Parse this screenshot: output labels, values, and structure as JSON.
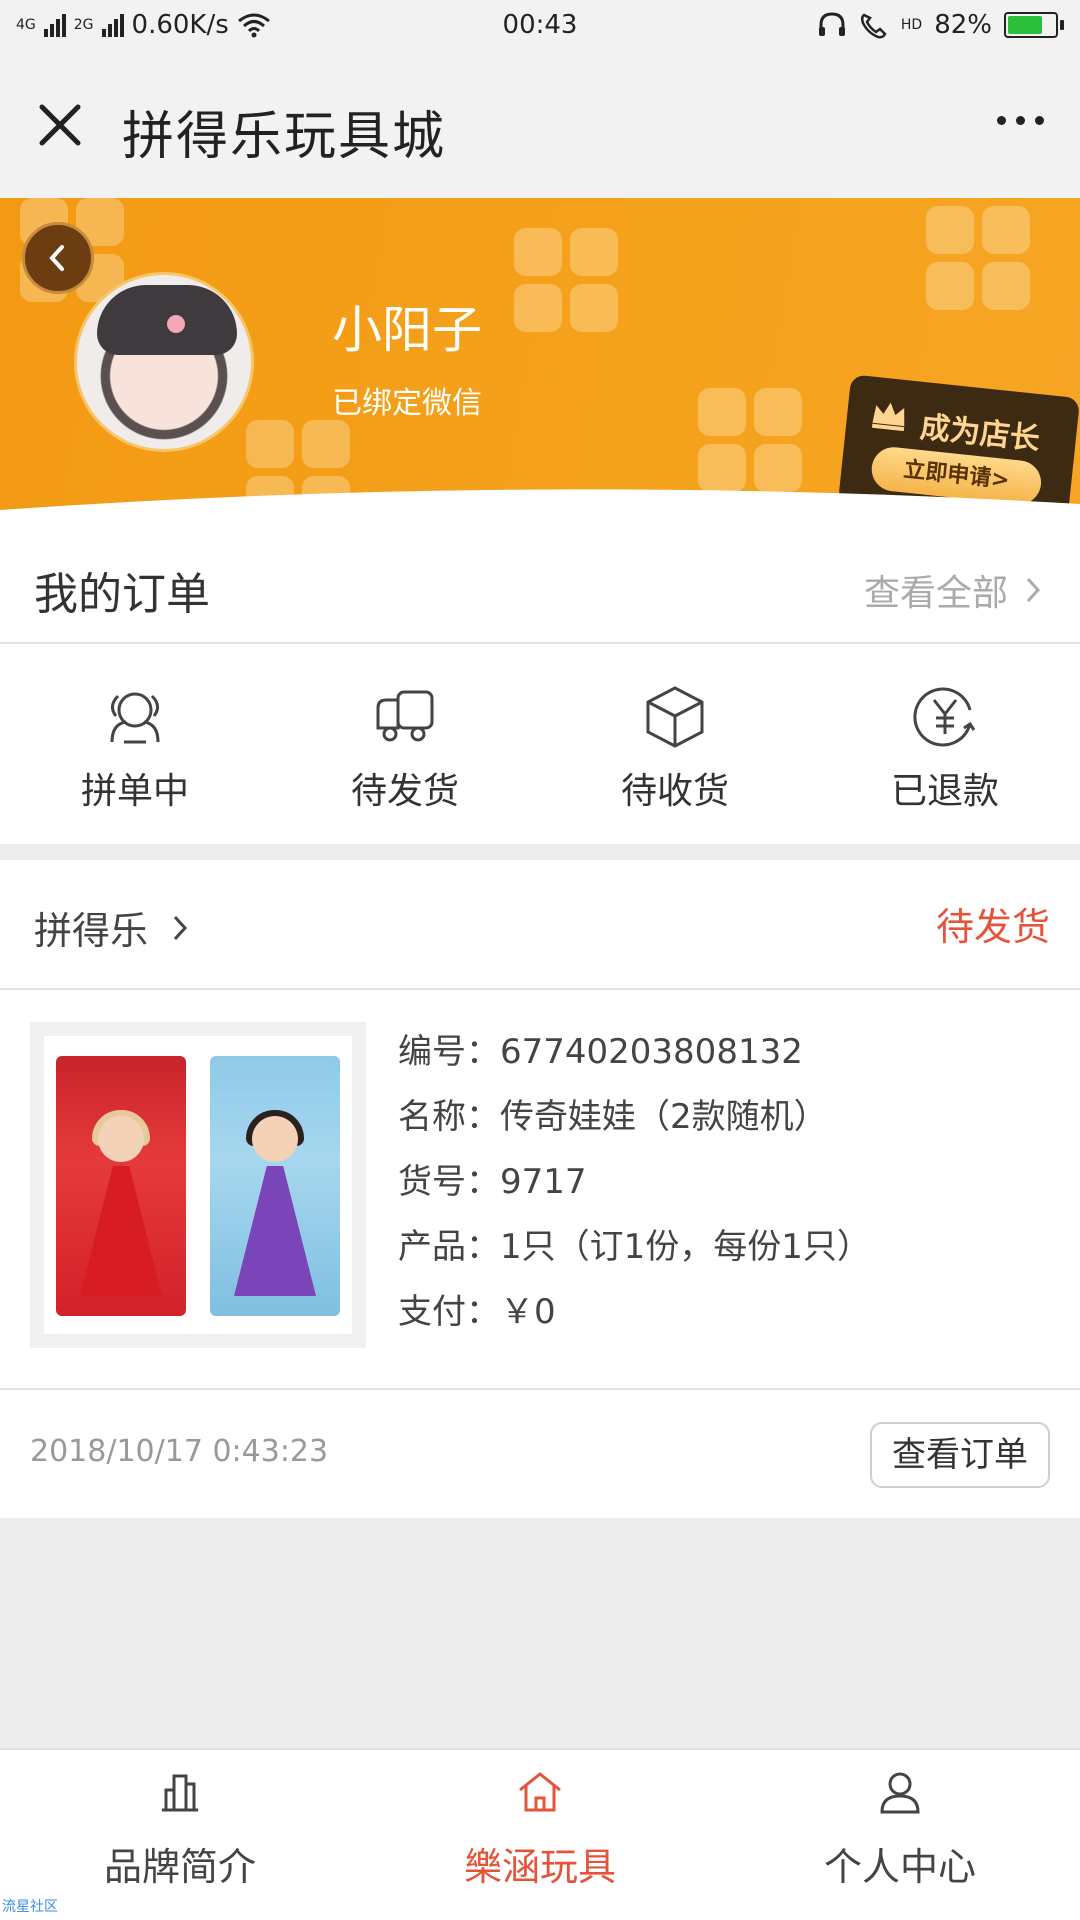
{
  "status_bar": {
    "network_1": "4G",
    "network_2": "2G",
    "speed": "0.60K/s",
    "time": "00:43",
    "hd_label": "HD",
    "battery_percent": "82%",
    "battery_level": 0.82,
    "icons": [
      "signal-icon",
      "wifi-icon",
      "headset-icon",
      "phone-hd-icon",
      "battery-icon"
    ]
  },
  "nav": {
    "title": "拼得乐玩具城",
    "close_icon": "close-icon",
    "more_icon": "more-icon"
  },
  "profile": {
    "username": "小阳子",
    "wechat_status": "已绑定微信",
    "owner_card": {
      "title": "成为店长",
      "button": "立即申请>"
    }
  },
  "orders": {
    "title": "我的订单",
    "view_all": "查看全部",
    "statuses": [
      {
        "label": "拼单中",
        "icon": "group-order-icon"
      },
      {
        "label": "待发货",
        "icon": "truck-icon"
      },
      {
        "label": "待收货",
        "icon": "package-icon"
      },
      {
        "label": "已退款",
        "icon": "refund-yen-icon"
      }
    ]
  },
  "order_card": {
    "shop": "拼得乐",
    "status": "待发货",
    "rows": [
      {
        "label": "编号：",
        "value": "67740203808132"
      },
      {
        "label": "名称：",
        "value": "传奇娃娃（2款随机）"
      },
      {
        "label": "货号：",
        "value": "9717"
      },
      {
        "label": "产品：",
        "value": "1只（订1份，每份1只）"
      },
      {
        "label": "支付：",
        "value": "￥0"
      }
    ],
    "time": "2018/10/17 0:43:23",
    "view_button": "查看订单"
  },
  "tabbar": {
    "tabs": [
      {
        "label": "品牌简介",
        "icon": "building-icon",
        "active": false
      },
      {
        "label": "樂涵玩具",
        "icon": "home-icon",
        "active": true
      },
      {
        "label": "个人中心",
        "icon": "user-icon",
        "active": false
      }
    ]
  },
  "watermark": "流星社区",
  "colors": {
    "accent": "#e5543a",
    "banner": "#f39a14",
    "battery": "#2bbf3a"
  }
}
